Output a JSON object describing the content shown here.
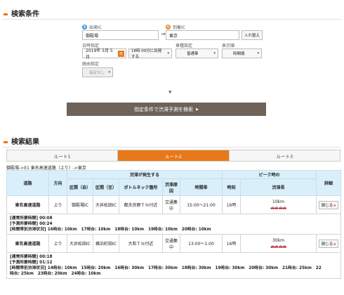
{
  "conditions": {
    "title": "検索条件",
    "from_badge": "S",
    "from_label": "出発IC",
    "from_value": "御殿場",
    "to_badge": "G",
    "to_label": "到着IC",
    "to_value": "東京",
    "swap_label": "入れ替え",
    "date_label": "日時指定",
    "date_value": "2019年 5月 5日",
    "cal_icon": "日",
    "time_value": "18時 00分に出発する",
    "vehicle_label": "車種指定",
    "vehicle_value": "普通車",
    "order_label": "表示順",
    "order_value": "時間順",
    "via_label": "経由指定",
    "via_value": "指定なし",
    "search_button": "指定条件で渋滞予測を検索",
    "search_arrow": "▶",
    "arrow": "→",
    "down": "▼",
    "caret": "▾"
  },
  "results": {
    "title": "検索結果",
    "tabs": [
      "ルート1",
      "ルート2",
      "ルート3"
    ],
    "active_tab": 1,
    "route_text": "御殿場->E1 東名高速道路（上り）->東京",
    "headers": {
      "road": "道路",
      "direction": "方向",
      "jam_group": "渋滞が発生する",
      "section_from": "区間（自）",
      "section_to": "区間（至）",
      "bottleneck": "ボトルネック箇所",
      "cause": "渋滞原因",
      "timeslot": "時間帯",
      "peak_group": "ピーク時の",
      "peak_time": "時刻",
      "jam_length": "渋滞長",
      "detail": "詳細"
    },
    "rows": [
      {
        "road": "東名高速道路",
        "direction": "上り",
        "from": "御殿場IC",
        "to": "大井松田IC",
        "bottleneck": "都夫良野ＴＮ付近",
        "cause": "交通集中",
        "timeslot": "15:00～21:00",
        "peak_time": "16時",
        "jam_length": "10km",
        "cars": "🚗🚗🚗🚗",
        "close": "閉じる",
        "info": [
          "[通常所要時間] 00:08",
          "[予測所要時間] 00:24",
          "[時間帯別渋滞状況] 16時台: 10km　17時台: 10km　18時台: 10km　19時台: 10km　20時台: 10km"
        ]
      },
      {
        "road": "東名高速道路",
        "direction": "上り",
        "from": "大井松田IC",
        "to": "横浜町田IC",
        "bottleneck": "大和ＴＮ付近",
        "cause": "交通集中",
        "timeslot": "13:00～1:00",
        "peak_time": "16時",
        "jam_length": "30km",
        "cars": "🚗🚗🚗🚗",
        "close": "閉じる",
        "info": [
          "[通常所要時間] 00:18",
          "[予測所要時間] 01:12",
          "[時間帯別渋滞状況] 14時台: 10km　15時台: 20km　16時台: 30km　17時台: 30km　18時台: 30km　19時台: 30km　20時台: 30km　21時台: 25km　22",
          "時台: 25km　23時台: 20km　24時台: 10km"
        ]
      }
    ]
  },
  "colors": {
    "accent": "#e8791a",
    "header_bg": "#d9f0fb",
    "button_bg": "#6e6259"
  }
}
